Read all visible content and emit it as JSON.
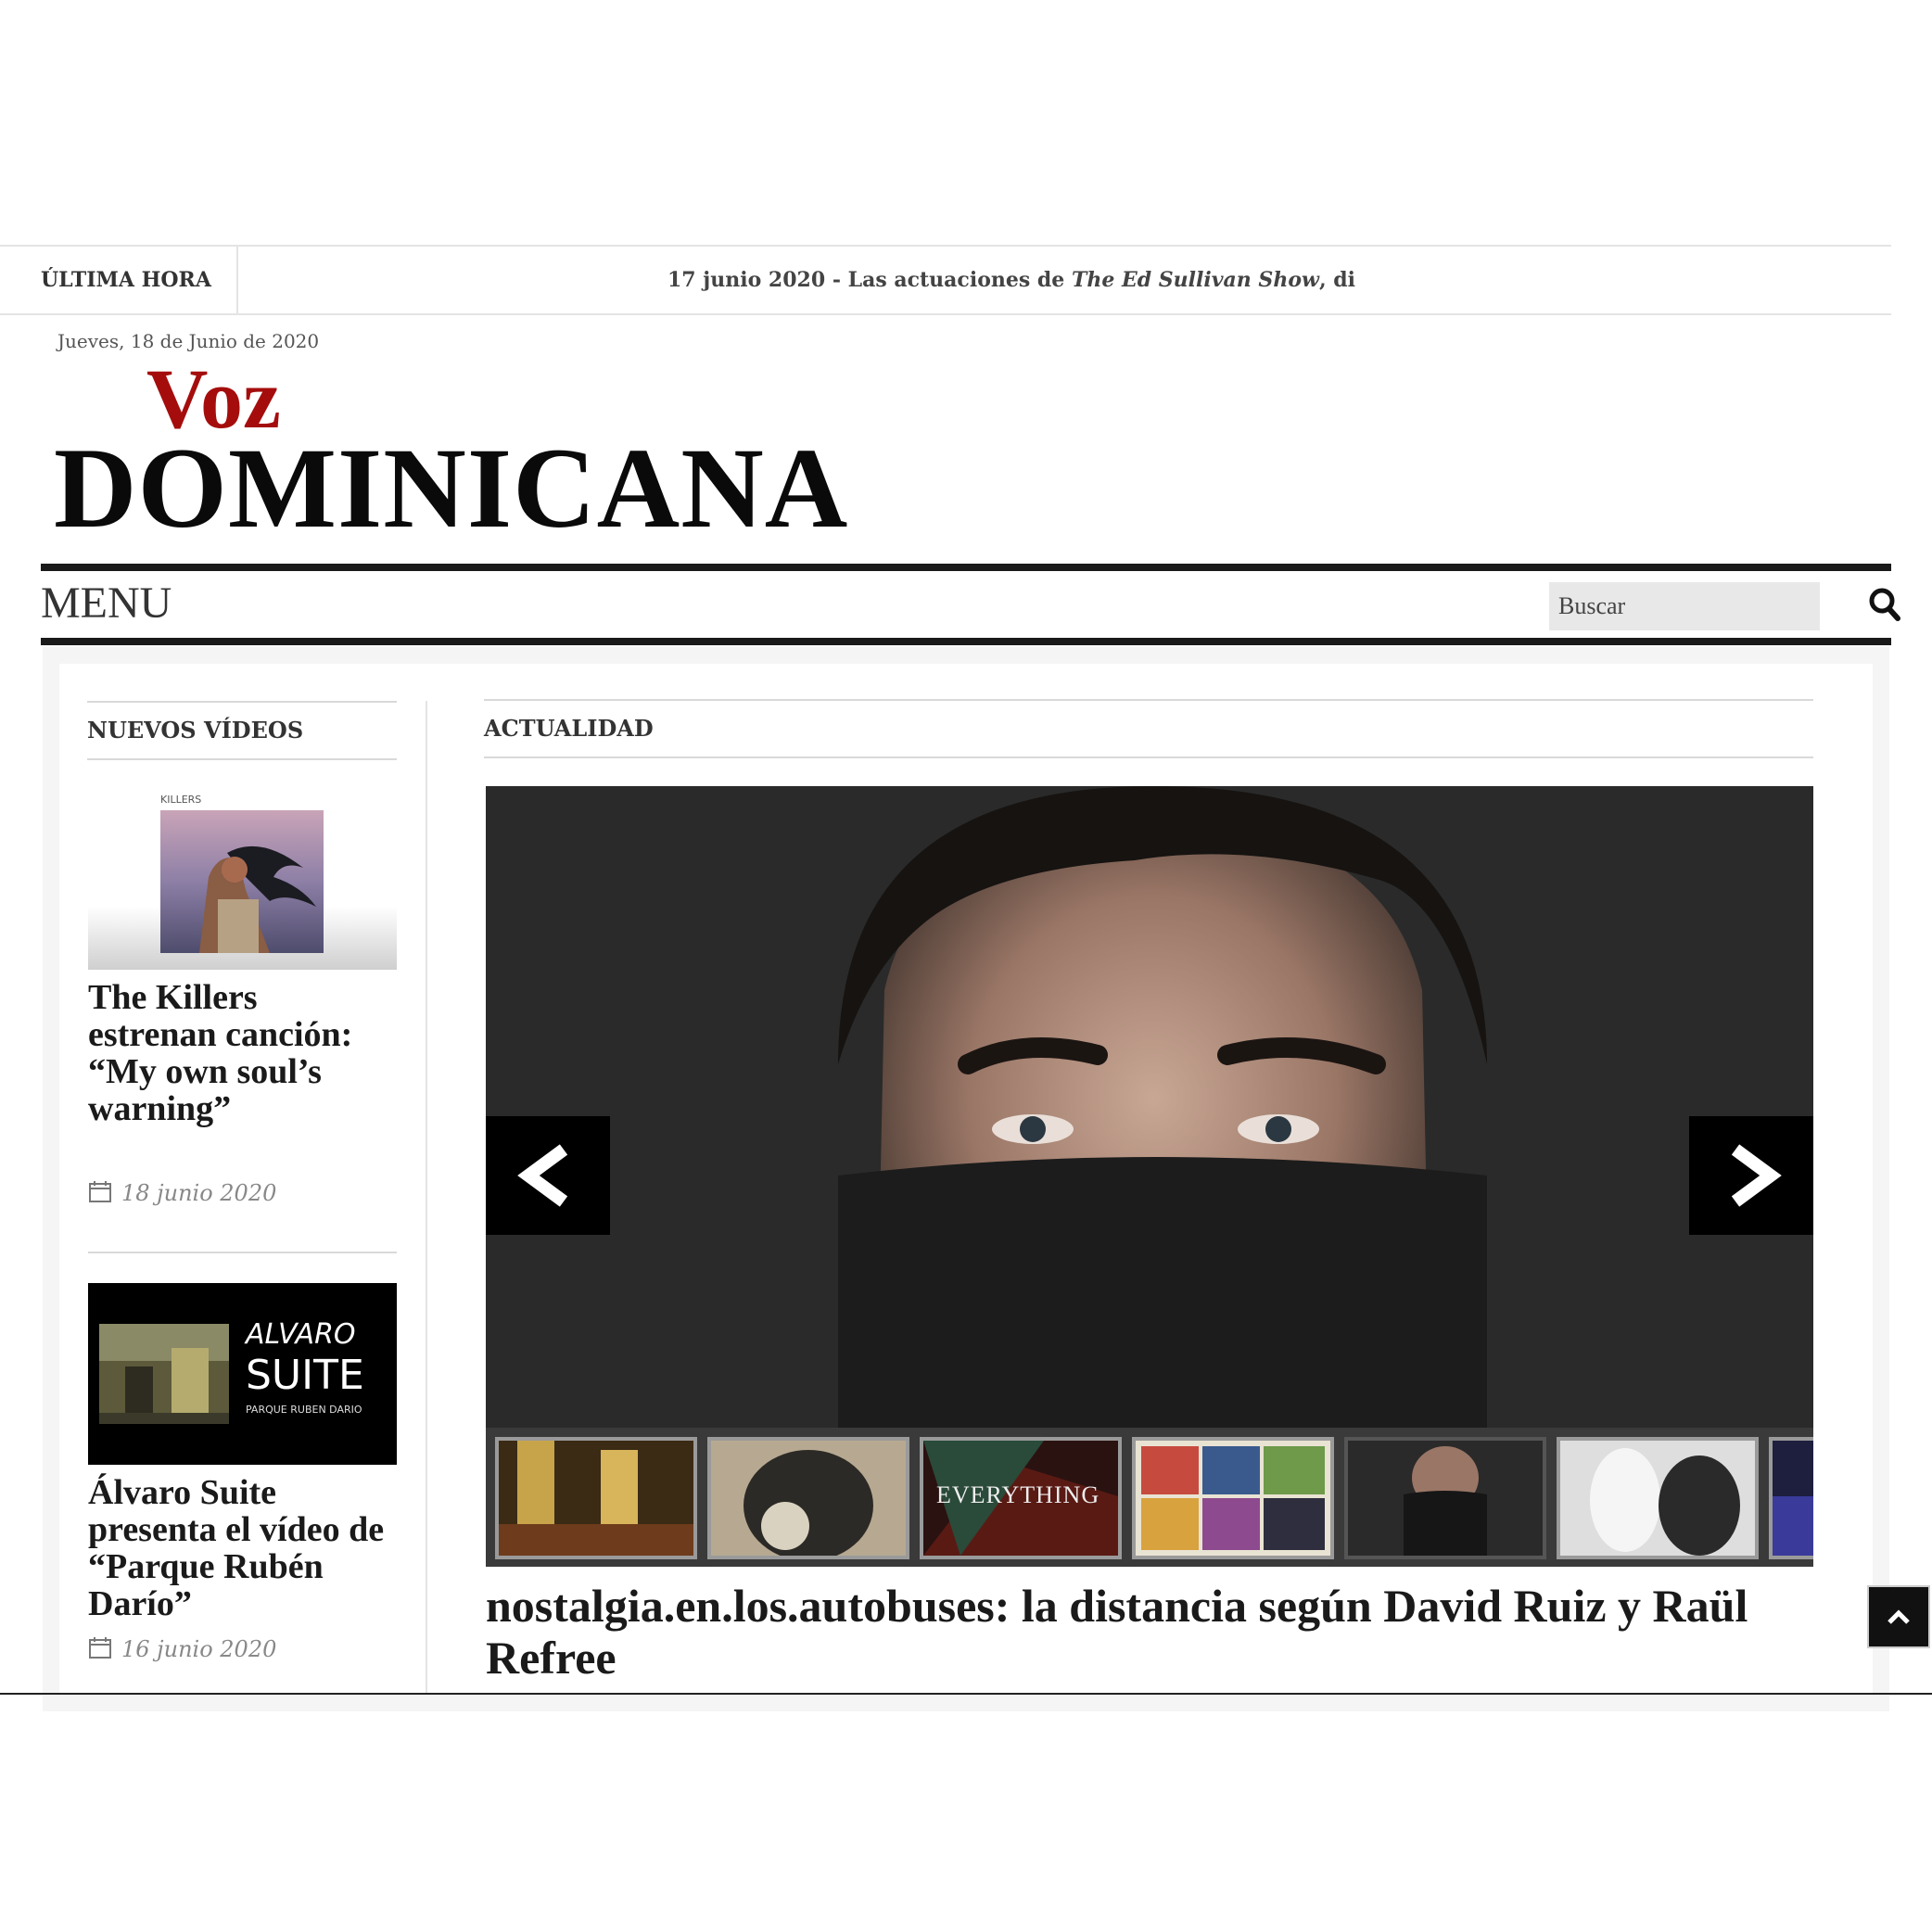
{
  "breaking": {
    "label": "ÚLTIMA HORA",
    "ticker_date": "17 junio 2020",
    "ticker_prefix": " - Las actuaciones de ",
    "ticker_italic": "The Ed Sullivan Show",
    "ticker_suffix": ", dispo"
  },
  "header": {
    "date": "Jueves, 18 de Junio de 2020",
    "logo_top": "Voz",
    "logo_bottom": "DOMINICANA"
  },
  "nav": {
    "menu_label": "MENU",
    "search_placeholder": "Buscar",
    "search_icon": "search-icon"
  },
  "sidebar": {
    "heading": "NUEVOS VÍDEOS",
    "items": [
      {
        "thumb_caption": "KILLERS",
        "title": "The Killers estrenan canción: “My own soul’s warning”",
        "date": "18 junio 2020"
      },
      {
        "thumb_caption_1": "ALVARO",
        "thumb_caption_2": "SUITE",
        "thumb_caption_3": "PARQUE RUBEN DARIO",
        "title": "Álvaro Suite presenta el vídeo de “Parque Rubén Darío”",
        "date": "16 junio 2020"
      }
    ]
  },
  "main": {
    "heading": "ACTUALIDAD",
    "slide_title": "nostalgia.en.los.autobuses: la distancia según David Ruiz y Raül Refree",
    "thumb_text_everything": "EVERYTHING",
    "active_thumb_index": 4,
    "thumb_count": 7
  },
  "colors": {
    "brand_red": "#a50d0d",
    "rule_dark": "#1a1a1a"
  }
}
